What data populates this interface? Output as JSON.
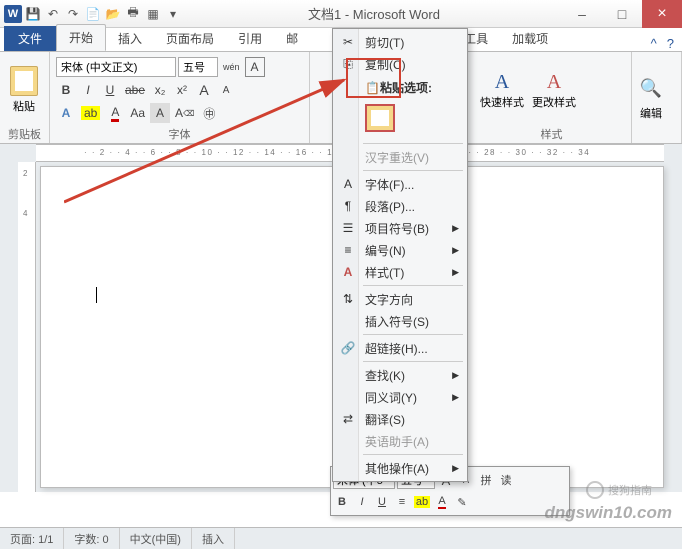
{
  "titlebar": {
    "title": "文档1 - Microsoft Word"
  },
  "winbtns": {
    "min": "–",
    "max": "□",
    "close": "×"
  },
  "tabs": {
    "file": "文件",
    "home": "开始",
    "insert": "插入",
    "layout": "页面布局",
    "references": "引用",
    "mail_prefix": "邮",
    "devtools_suffix": "发工具",
    "addins": "加载项"
  },
  "ribbon": {
    "clipboard": {
      "paste": "粘贴",
      "group": "剪贴板"
    },
    "font": {
      "name": "宋体 (中文正文)",
      "size": "五号",
      "group": "字体",
      "bold": "B",
      "italic": "I",
      "underline": "U",
      "strike": "abe",
      "sub": "x₂",
      "sup": "x²",
      "phonetic": "拼",
      "border": "A",
      "grow": "A",
      "shrink": "A",
      "case": "Aa",
      "clear": "A",
      "highlight": "A",
      "fontcolor": "A",
      "charshade": "A",
      "enclosed": "㊥"
    },
    "styles": {
      "quick": "快速样式",
      "change": "更改样式",
      "group": "样式"
    },
    "editing": {
      "label": "编辑",
      "icon": "🔍"
    }
  },
  "context_menu": {
    "cut": "剪切(T)",
    "copy": "复制(C)",
    "paste_header": "粘贴选项:",
    "reconvert": "汉字重选(V)",
    "font": "字体(F)...",
    "paragraph": "段落(P)...",
    "bullets": "项目符号(B)",
    "numbering": "编号(N)",
    "styles": "样式(T)",
    "textdir": "文字方向",
    "symbol": "插入符号(S)",
    "hyperlink": "超链接(H)...",
    "find": "查找(K)",
    "synonyms": "同义词(Y)",
    "translate": "翻译(S)",
    "assistant": "英语助手(A)",
    "other": "其他操作(A)"
  },
  "mini": {
    "font": "宋体 (中5",
    "size": "五号",
    "grow": "A",
    "shrink": "A",
    "phon": "拼",
    "read": "读",
    "bold": "B",
    "italic": "I",
    "underline": "U"
  },
  "statusbar": {
    "page": "页面: 1/1",
    "words": "字数: 0",
    "lang": "中文(中国)",
    "insert": "插入"
  },
  "watermark": {
    "logo": "搜狗指南",
    "url": "dngswin10.com"
  }
}
